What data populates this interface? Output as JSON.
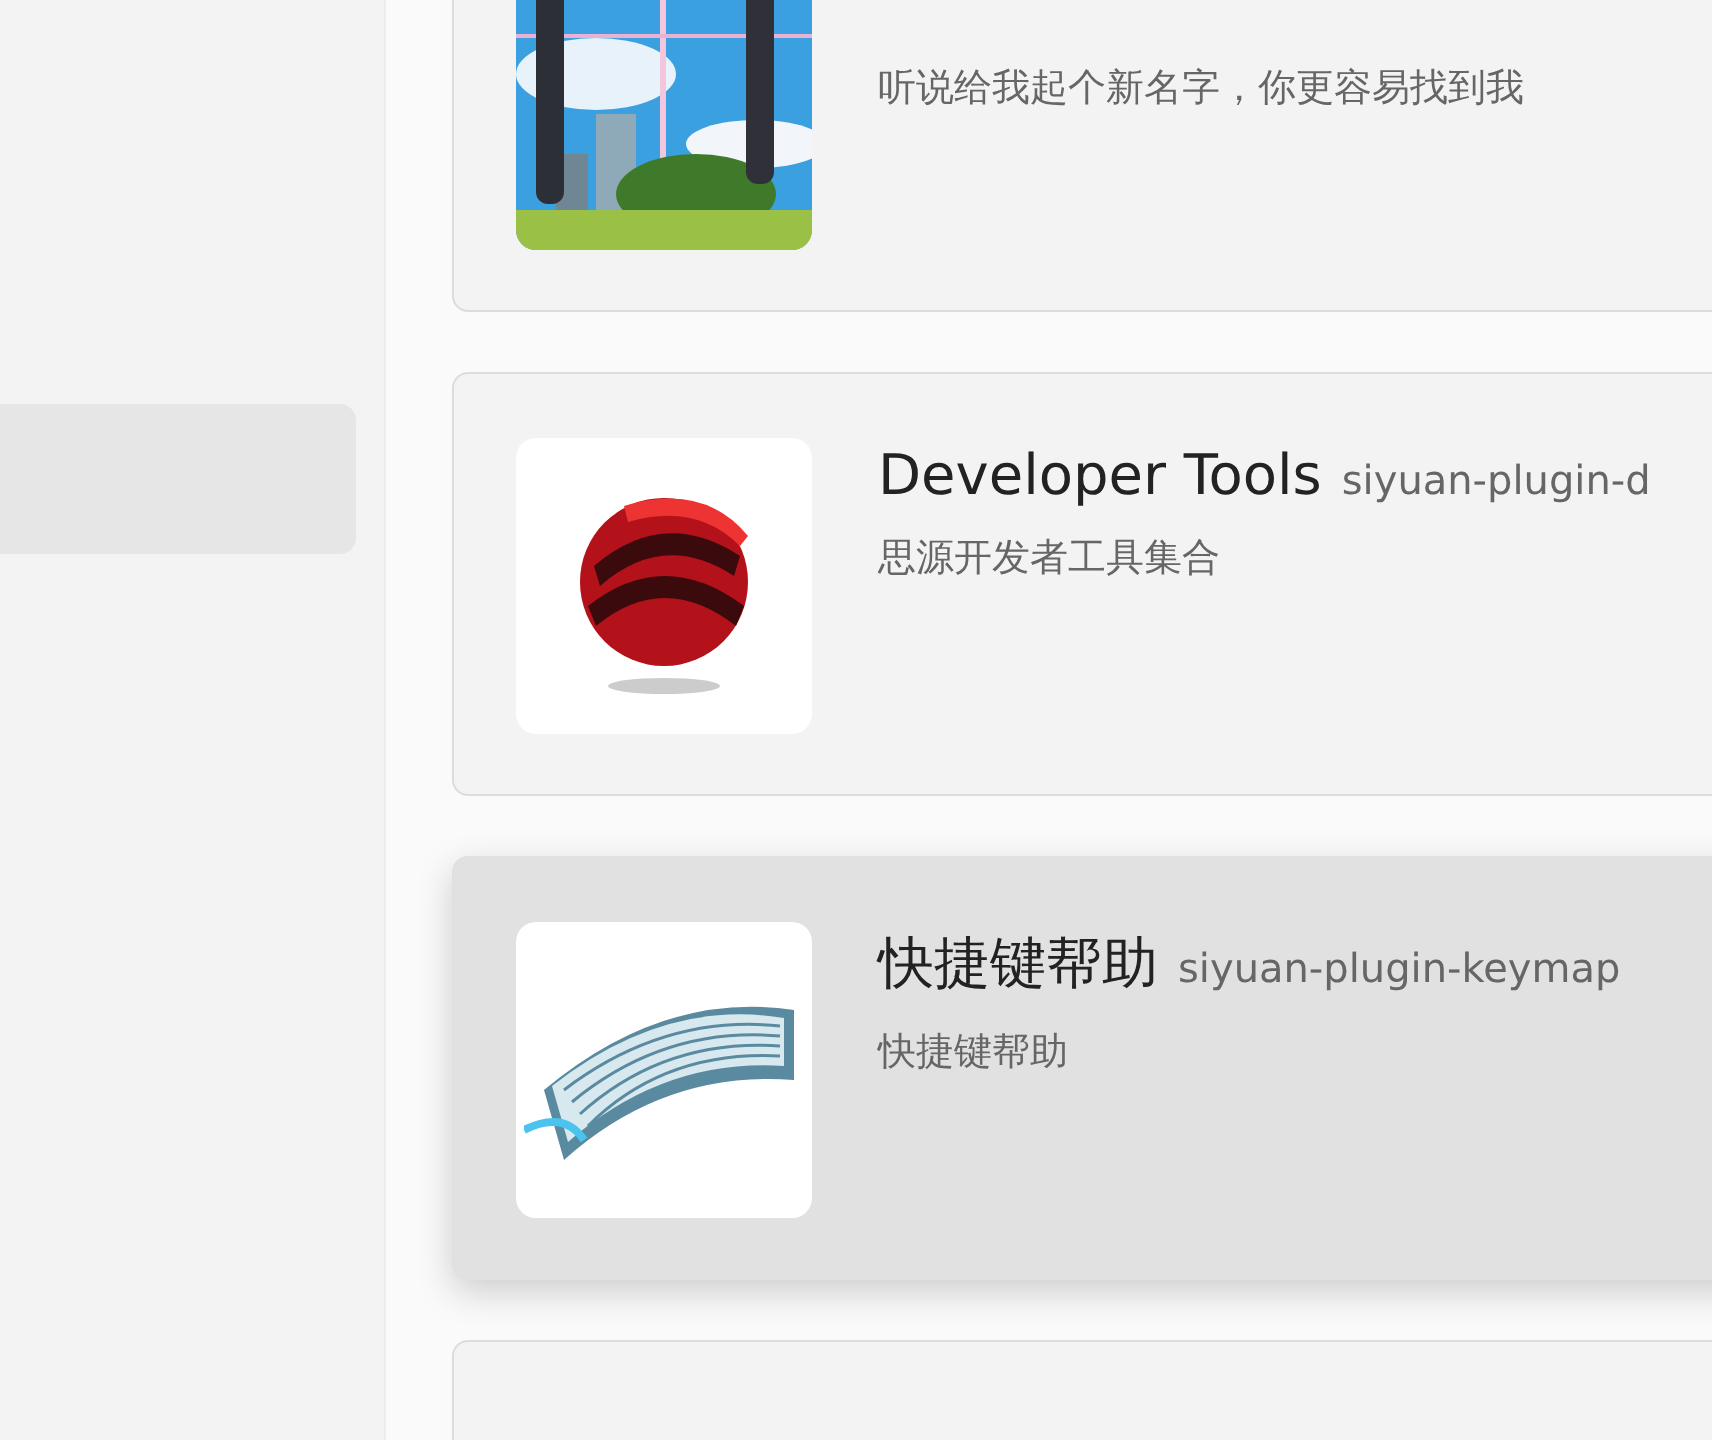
{
  "sidebar": {
    "items": [
      {
        "selected": true
      }
    ]
  },
  "plugins": [
    {
      "kind": "picture",
      "description": "听说给我起个新名字，你更容易找到我",
      "highlighted": false
    },
    {
      "kind": "swirl",
      "name": "Developer Tools",
      "package": "siyuan-plugin-d",
      "description": "思源开发者工具集合",
      "highlighted": false
    },
    {
      "kind": "keyboard",
      "name": "快捷键帮助",
      "package": "siyuan-plugin-keymap",
      "description": "快捷键帮助",
      "highlighted": true
    },
    {
      "kind": "blank",
      "highlighted": false
    }
  ]
}
